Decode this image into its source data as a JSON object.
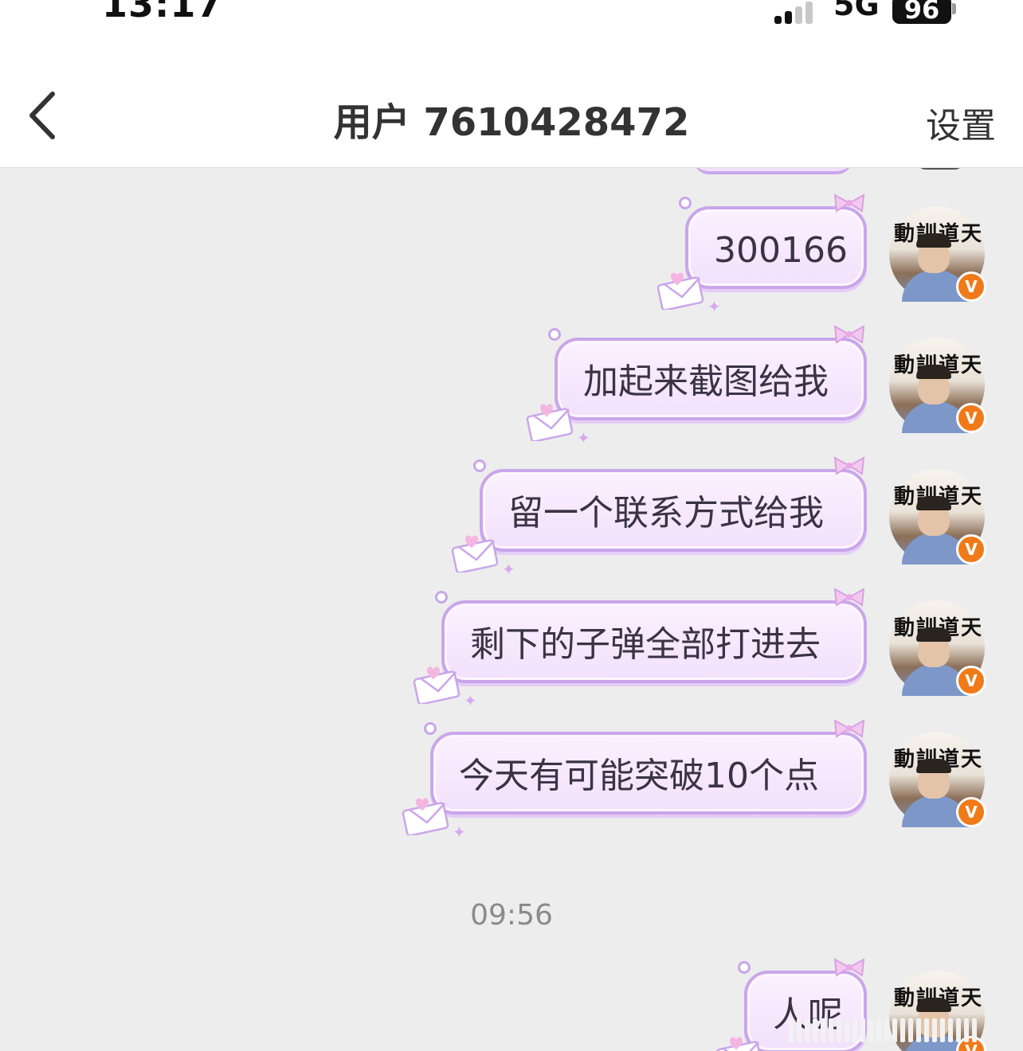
{
  "status_bar": {
    "time": "13:17",
    "network": "5G",
    "battery": "96"
  },
  "header": {
    "title": "用户 7610428472",
    "settings_label": "设置"
  },
  "messages": [
    {
      "text": "300166"
    },
    {
      "text": "加起来截图给我"
    },
    {
      "text": "留一个联系方式给我"
    },
    {
      "text": "剩下的子弹全部打进去"
    },
    {
      "text": "今天有可能突破10个点"
    },
    {
      "text": "人呢"
    }
  ],
  "avatar": {
    "calligraphy": "動訓道天",
    "badge": "V"
  },
  "timestamp": "09:56",
  "colors": {
    "bubble_border": "#c9a6ea",
    "bubble_fill": "#f5e6fc",
    "badge": "#f07a1a",
    "background": "#ededed"
  }
}
